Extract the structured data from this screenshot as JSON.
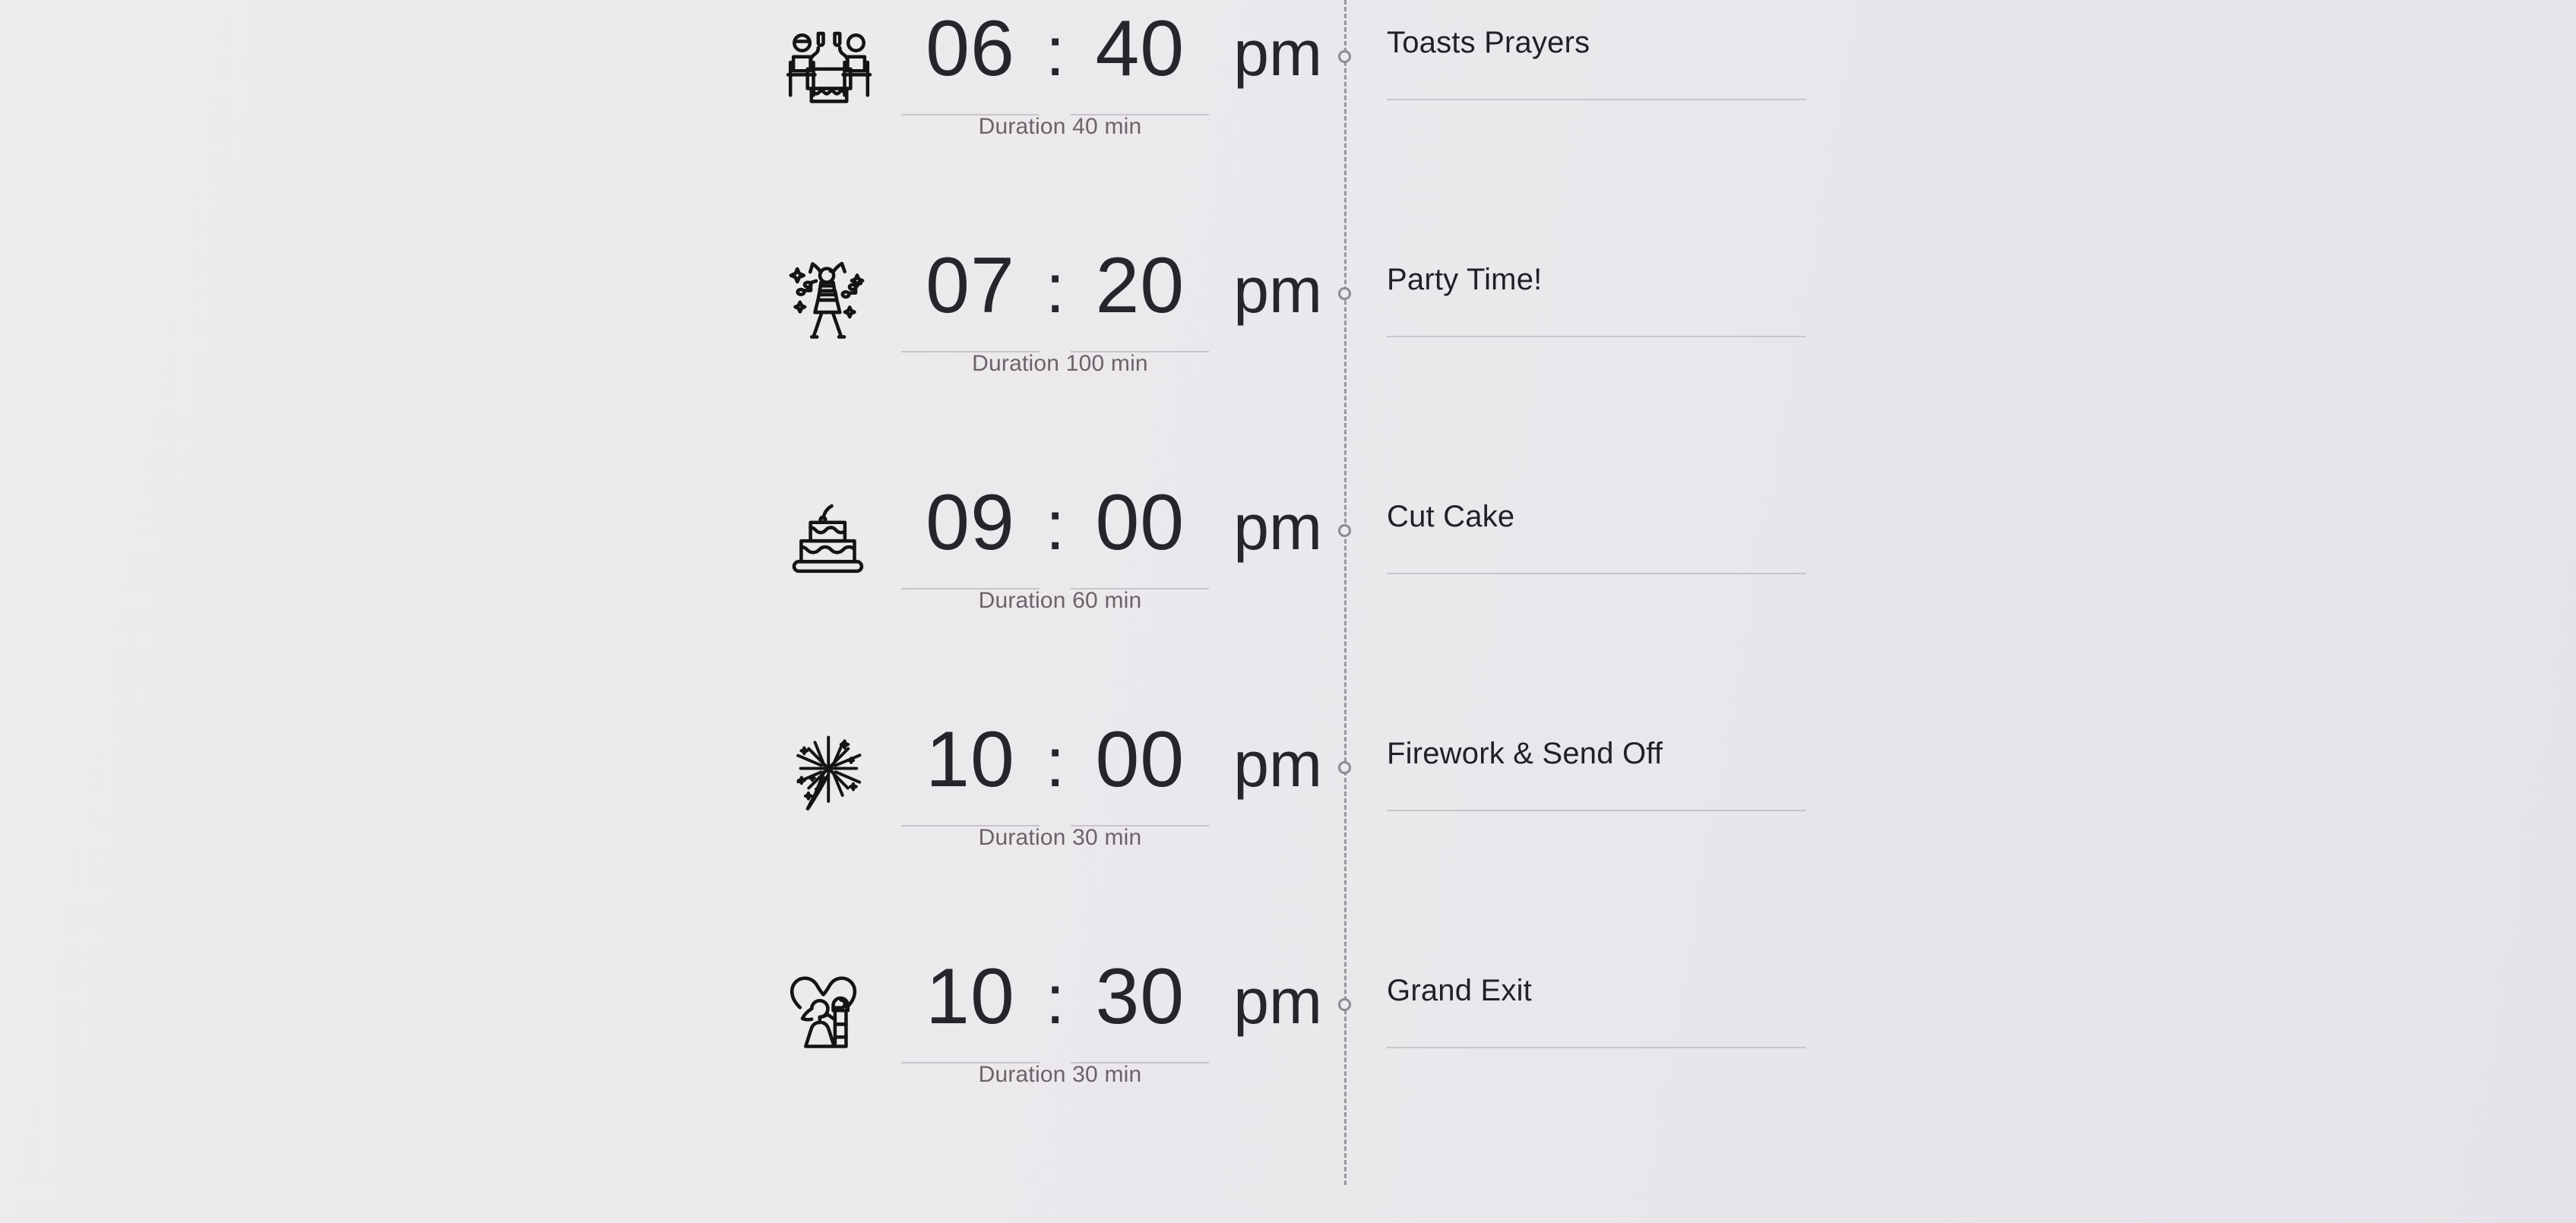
{
  "theme": {
    "background_left": "#edebec",
    "background_right": "#e5e3e9",
    "text_primary": "#24262c",
    "text_muted": "#6b6369",
    "rule_color": "#c9c5cb",
    "spine_color": "#8d8a90"
  },
  "timeline": {
    "events": [
      {
        "icon": "dinner-table-icon",
        "hour": "06",
        "separator": ":",
        "minute": "40",
        "meridiem": "pm",
        "duration": "Duration 40 min",
        "name": "Toasts Prayers"
      },
      {
        "icon": "dancing-person-icon",
        "hour": "07",
        "separator": ":",
        "minute": "20",
        "meridiem": "pm",
        "duration": "Duration 100 min",
        "name": "Party Time!"
      },
      {
        "icon": "wedding-cake-icon",
        "hour": "09",
        "separator": ":",
        "minute": "00",
        "meridiem": "pm",
        "duration": "Duration 60 min",
        "name": "Cut Cake"
      },
      {
        "icon": "firework-icon",
        "hour": "10",
        "separator": ":",
        "minute": "00",
        "meridiem": "pm",
        "duration": "Duration 30 min",
        "name": "Firework & Send Off"
      },
      {
        "icon": "couple-heart-icon",
        "hour": "10",
        "separator": ":",
        "minute": "30",
        "meridiem": "pm",
        "duration": "Duration 30 min",
        "name": "Grand Exit"
      }
    ]
  }
}
